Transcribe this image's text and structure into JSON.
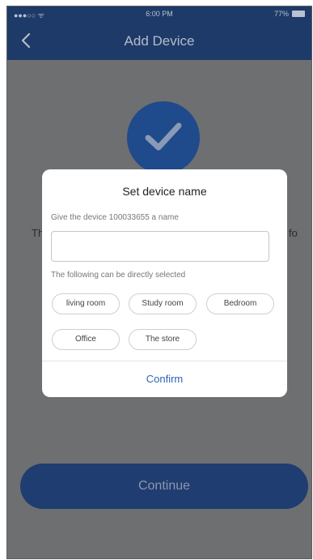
{
  "status_bar": {
    "carrier": "●●●○○ ᯤ",
    "time": "6:00 PM",
    "battery": "77%"
  },
  "nav": {
    "title": "Add Device"
  },
  "background": {
    "text_left": "Th",
    "text_right": "fo",
    "continue_label": "Continue"
  },
  "dialog": {
    "title": "Set device name",
    "prompt": "Give the device 100033655 a name",
    "input_value": "",
    "input_placeholder": "",
    "hint": "The following can be directly selected",
    "chips": [
      "living room",
      "Study room",
      "Bedroom",
      "Office",
      "The store"
    ],
    "confirm_label": "Confirm"
  },
  "colors": {
    "nav_bg": "#1e3a68",
    "accent": "#2f63b3",
    "overlay": "#6e6f71"
  }
}
